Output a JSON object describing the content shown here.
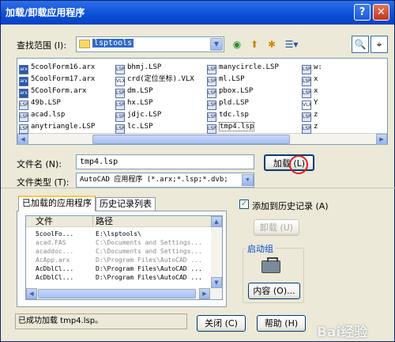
{
  "titlebar": {
    "title": "加载/卸载应用程序",
    "help": "?",
    "close": "✕"
  },
  "lookin": {
    "label": "查找范围 (I):",
    "value": "lsptools"
  },
  "toolbar": {
    "back": "◉",
    "up": "⬆",
    "newfolder": "✱",
    "views": "☰▾"
  },
  "files": [
    {
      "name": "5coolForm16.arx",
      "type": "arx"
    },
    {
      "name": "5CoolForm17.arx",
      "type": "arx"
    },
    {
      "name": "5CoolForm.arx",
      "type": "arx"
    },
    {
      "name": "49b.LSP",
      "type": "lsp"
    },
    {
      "name": "acad.lsp",
      "type": "lsp"
    },
    {
      "name": "anytriangle.LSP",
      "type": "lsp"
    },
    {
      "name": "bhmj.LSP",
      "type": "lsp"
    },
    {
      "name": "crd(定位坐标).VLX",
      "type": "vlx"
    },
    {
      "name": "dm.LSP",
      "type": "lsp"
    },
    {
      "name": "hx.LSP",
      "type": "lsp"
    },
    {
      "name": "jdjc.LSP",
      "type": "lsp"
    },
    {
      "name": "lc.LSP",
      "type": "lsp"
    },
    {
      "name": "manycircle.LSP",
      "type": "lsp"
    },
    {
      "name": "ml.LSP",
      "type": "lsp"
    },
    {
      "name": "pbox.LSP",
      "type": "lsp"
    },
    {
      "name": "pld.LSP",
      "type": "lsp"
    },
    {
      "name": "tdc.lsp",
      "type": "lsp"
    },
    {
      "name": "tmp4.lsp",
      "type": "lsp"
    },
    {
      "name": "w:",
      "type": "lsp"
    },
    {
      "name": "x",
      "type": "lsp"
    },
    {
      "name": "x",
      "type": "lsp"
    },
    {
      "name": "Y",
      "type": "vlx"
    },
    {
      "name": "z",
      "type": "lsp"
    },
    {
      "name": "z",
      "type": "lsp"
    }
  ],
  "filename": {
    "label": "文件名 (N):",
    "value": "tmp4.lsp"
  },
  "filetype": {
    "label": "文件类型 (T):",
    "value": "AutoCAD 应用程序 (*.arx;*.lsp;*.dvb;"
  },
  "load_button": "加载 (L)",
  "tabs": {
    "loaded": "已加载的应用程序",
    "history": "历史记录列表"
  },
  "loaded_list": {
    "col_file": "文件",
    "col_path": "路径",
    "rows": [
      {
        "file": "5coolFo...",
        "path": "E:\\lsptools\\",
        "dim": false
      },
      {
        "file": "acad.FAS",
        "path": "C:\\Documents and Settings...",
        "dim": true
      },
      {
        "file": "acaddoc...",
        "path": "C:\\Documents and Settings...",
        "dim": true
      },
      {
        "file": "AcApp.arx",
        "path": "D:\\Program Files\\AutoCAD ...",
        "dim": true
      },
      {
        "file": "AcDblCl...",
        "path": "D:\\Program Files\\AutoCAD ...",
        "dim": false
      },
      {
        "file": "AcDblCl...",
        "path": "D:\\Program Files\\AutoCAD ...",
        "dim": false
      }
    ]
  },
  "add_history": {
    "label": "添加到历史记录 (A)",
    "checked": "✓"
  },
  "unload_button": "卸载 (U)",
  "startup_group": {
    "title": "启动组",
    "contents_button": "内容 (O)..."
  },
  "status_text": "已成功加载 tmp4.lsp。",
  "close_button": "关闭 (C)",
  "help_button": "帮助 (H)",
  "watermark": "Bai经验"
}
